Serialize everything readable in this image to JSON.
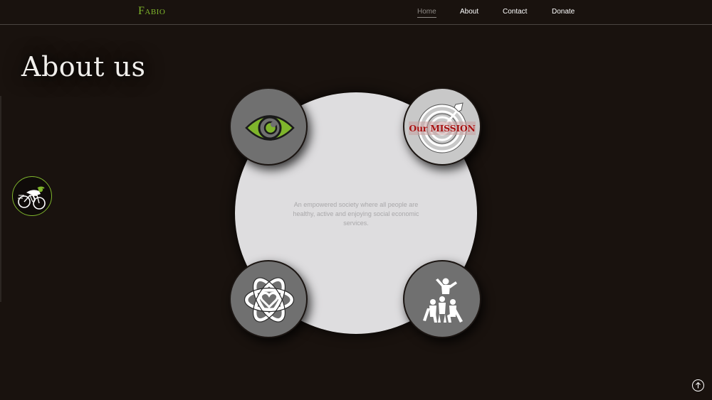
{
  "brand": {
    "name": "Fabio"
  },
  "nav": {
    "items": [
      {
        "label": "Home",
        "active": true
      },
      {
        "label": "About",
        "active": false
      },
      {
        "label": "Contact",
        "active": false
      },
      {
        "label": "Donate",
        "active": false
      }
    ]
  },
  "main": {
    "title": "About us",
    "vision_text": "An empowered society where all people are healthy, active and enjoying social economic services."
  },
  "cards": [
    {
      "name": "vision",
      "icon": "eye-icon"
    },
    {
      "name": "mission",
      "icon": "target-icon",
      "label": "Our MISSION"
    },
    {
      "name": "values",
      "icon": "atom-heart-icon"
    },
    {
      "name": "team",
      "icon": "people-pyramid-icon"
    }
  ],
  "widgets": {
    "cyclist_icon": "cyclist-icon",
    "scroll_top_icon": "arrow-up-icon"
  },
  "colors": {
    "background": "#19120e",
    "accent": "#7fb52c",
    "center_circle": "#dedddf",
    "corner_dark": "#707070",
    "corner_light": "#c8c8c8",
    "mission_red": "#a51010"
  }
}
